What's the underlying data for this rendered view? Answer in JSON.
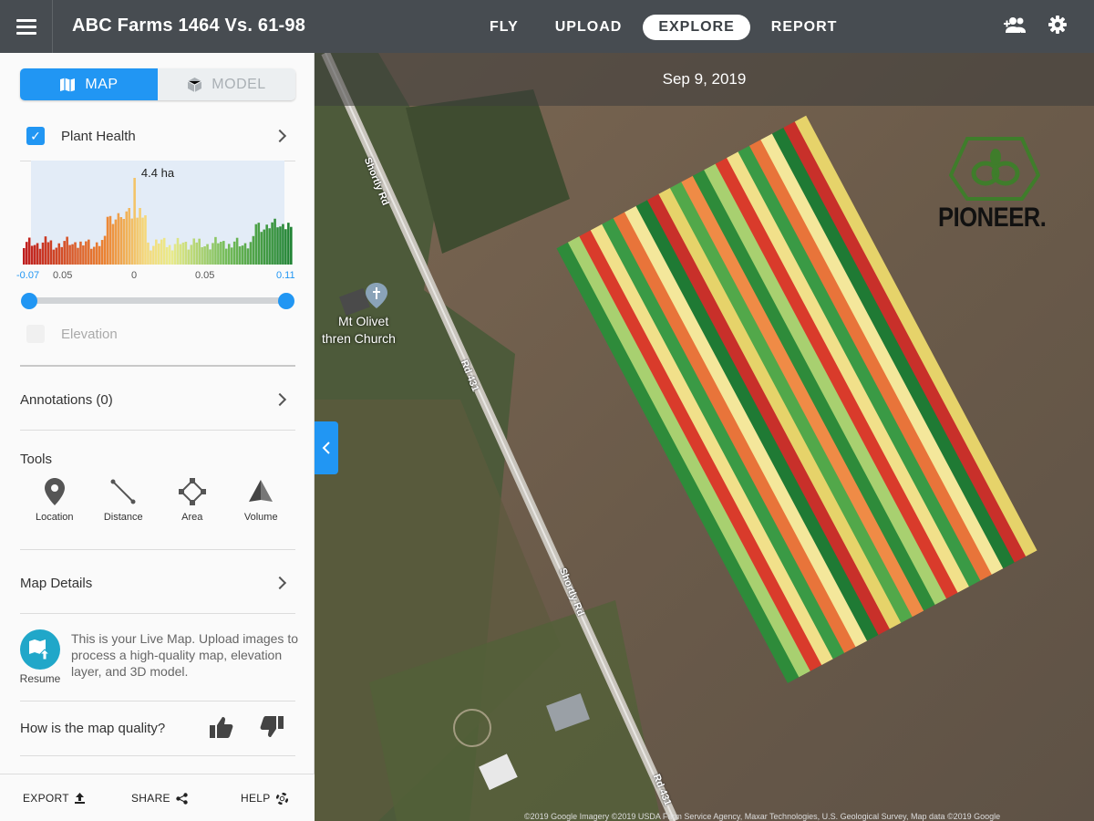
{
  "header": {
    "title": "ABC Farms 1464 Vs. 61-98",
    "tabs": [
      {
        "label": "FLY",
        "active": false
      },
      {
        "label": "UPLOAD",
        "active": false
      },
      {
        "label": "EXPLORE",
        "active": true
      },
      {
        "label": "REPORT",
        "active": false
      }
    ],
    "icons": [
      "menu-icon",
      "add-user-icon",
      "gear-icon"
    ]
  },
  "sidebar": {
    "view_toggle": {
      "map_label": "MAP",
      "model_label": "MODEL",
      "selected": "MAP"
    },
    "plant_health": {
      "label": "Plant Health",
      "checked": true
    },
    "histogram": {
      "area_label": "4.4 ha",
      "ticks": [
        "-0.07",
        "0.05",
        "0",
        "0.05",
        "0.11"
      ],
      "range_min": "-0.07",
      "range_max": "0.11"
    },
    "elevation": {
      "label": "Elevation",
      "checked": false
    },
    "annotations_label": "Annotations (0)",
    "tools": {
      "heading": "Tools",
      "items": [
        {
          "label": "Location",
          "icon": "pin-icon"
        },
        {
          "label": "Distance",
          "icon": "ruler-icon"
        },
        {
          "label": "Area",
          "icon": "polygon-icon"
        },
        {
          "label": "Volume",
          "icon": "cone-icon"
        }
      ]
    },
    "map_details_label": "Map Details",
    "live_map": {
      "resume_label": "Resume",
      "message": "This is your Live Map. Upload images to process a high-quality map, elevation layer, and 3D model."
    },
    "quality": {
      "question": "How is the map quality?"
    },
    "footer": {
      "export": "EXPORT",
      "share": "SHARE",
      "help": "HELP"
    }
  },
  "map": {
    "date": "Sep 9, 2019",
    "place_label_line1": "Mt Olivet",
    "place_label_line2": "thren Church",
    "road_labels": [
      "Shortly Rd",
      "Rd 431",
      "Shortly Rd",
      "Rd 431"
    ],
    "attribution": "©2019 Google  Imagery ©2019 USDA Farm Service Agency, Maxar Technologies, U.S. Geological Survey, Map data ©2019 Google",
    "logo_text": "PIONEER."
  }
}
